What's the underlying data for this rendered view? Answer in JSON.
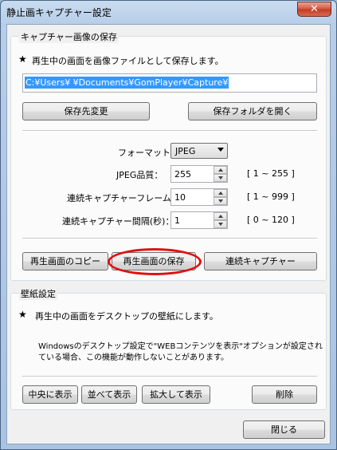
{
  "window": {
    "title": "静止画キャプチャー設定",
    "close_glyph": "✕"
  },
  "capture_group": {
    "title": "キャプチャー画像の保存",
    "description_star": "★",
    "description": "再生中の画面を画像ファイルとして保存します。",
    "path_value": "C:¥Users¥            ¥Documents¥GomPlayer¥Capture¥",
    "change_dest_label": "保存先変更",
    "open_folder_label": "保存フォルダを開く",
    "format_label": "フォーマット：",
    "format_value": "JPEG",
    "jpeg_quality_label": "JPEG品質：",
    "jpeg_quality_value": "255",
    "jpeg_quality_range": "[ 1 ~ 255 ]",
    "frames_label": "連続キャプチャーフレーム：",
    "frames_value": "10",
    "frames_range": "[ 1 ~ 999 ]",
    "interval_label": "連続キャプチャー間隔(秒)：",
    "interval_value": "1",
    "interval_range": "[ 0 ~ 120 ]",
    "copy_label": "再生画面のコピー",
    "save_label": "再生画面の保存",
    "continuous_label": "連続キャプチャー"
  },
  "wallpaper_group": {
    "title": "壁紙設定",
    "description_star": "★",
    "description": "再生中の画面をデスクトップの壁紙にします。",
    "note_line1": "Windowsのデスクトップ設定で\"WEBコンテンツを表示\"オプションが設定され",
    "note_line2": "ている場合、この機能が動作しないことがあります。",
    "center_label": "中央に表示",
    "tile_label": "並べて表示",
    "stretch_label": "拡大して表示",
    "delete_label": "削除"
  },
  "footer": {
    "close_label": "閉じる"
  },
  "colors": {
    "selection": "#3399ff",
    "highlight_ring": "#e01010"
  }
}
